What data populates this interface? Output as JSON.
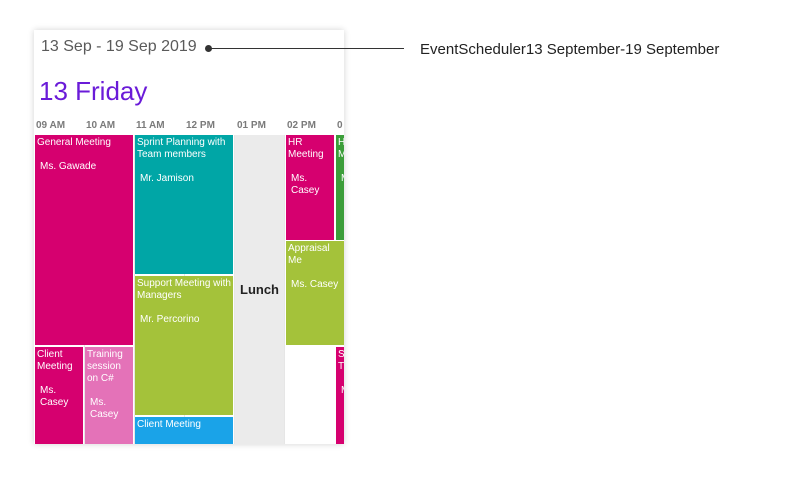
{
  "header": {
    "date_range": "13 Sep - 19 Sep 2019",
    "day_header": "13 Friday"
  },
  "time_labels": [
    "09 AM",
    "10 AM",
    "11 AM",
    "12 PM",
    "01 PM",
    "02 PM",
    "0"
  ],
  "lunch_label": "Lunch",
  "events": [
    {
      "title": "General Meeting",
      "person": "Ms. Gawade",
      "color": "#d6006f"
    },
    {
      "title": "Sprint Planning with Team members",
      "person": "Mr. Jamison",
      "color": "#00a6a6"
    },
    {
      "title": "HR Meeting",
      "person": "Ms. Casey",
      "color": "#d6006f"
    },
    {
      "title": "H M",
      "person": "M",
      "color": "#3c9e3a"
    },
    {
      "title": "Support Meeting with Managers",
      "person": "Mr. Percorino",
      "color": "#a4c23a"
    },
    {
      "title": "Appraisal Me",
      "person": "Ms. Casey",
      "color": "#a4c23a"
    },
    {
      "title": "Client Meeting",
      "person": "Ms. Casey",
      "color": "#d6006f"
    },
    {
      "title": "Training session on C#",
      "person": "Ms. Casey",
      "color": "#e472b8"
    },
    {
      "title": "Client Meeting",
      "person": "",
      "color": "#1aa3e8"
    },
    {
      "title": "S T",
      "person": "M",
      "color": "#d6006f"
    }
  ],
  "annotation": {
    "text": "EventScheduler13 September-19 September"
  }
}
